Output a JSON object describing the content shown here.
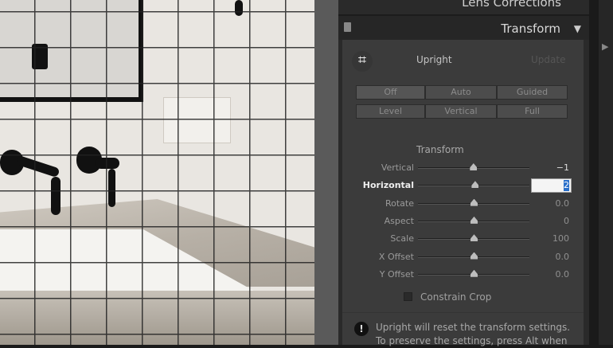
{
  "panel": {
    "prev_section": "Lens Corrections",
    "section_title": "Transform",
    "upright_label": "Upright",
    "update_label": "Update",
    "upright_buttons": [
      "Off",
      "Auto",
      "Guided",
      "Level",
      "Vertical",
      "Full"
    ],
    "active_button": "Off",
    "transform_heading": "Transform",
    "sliders": [
      {
        "label": "Vertical",
        "value": "−1",
        "level": -0.01
      },
      {
        "label": "Horizontal",
        "value": "2",
        "level": 0.02,
        "editing": true
      },
      {
        "label": "Rotate",
        "value": "0.0",
        "level": 0
      },
      {
        "label": "Aspect",
        "value": "0",
        "level": 0
      },
      {
        "label": "Scale",
        "value": "100",
        "level": 0
      },
      {
        "label": "X Offset",
        "value": "0.0",
        "level": 0
      },
      {
        "label": "Y Offset",
        "value": "0.0",
        "level": 0
      }
    ],
    "constrain_crop_label": "Constrain Crop",
    "constrain_crop_checked": false,
    "warning_text": "Upright will reset the transform settings. To preserve the settings, press Alt when"
  }
}
